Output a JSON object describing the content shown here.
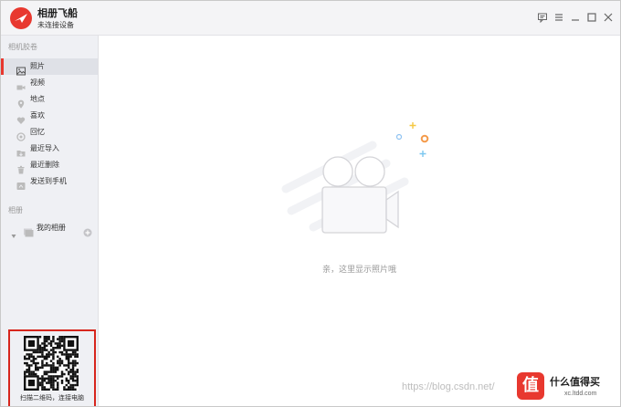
{
  "app": {
    "title": "相册飞船",
    "subtitle": "未连接设备"
  },
  "sidebar": {
    "section_local": "相机胶卷",
    "items": [
      {
        "label": "照片",
        "icon": "photo-icon",
        "active": true
      },
      {
        "label": "视频",
        "icon": "video-icon"
      },
      {
        "label": "地点",
        "icon": "location-pin-icon"
      },
      {
        "label": "喜欢",
        "icon": "heart-icon"
      },
      {
        "label": "回忆",
        "icon": "memories-icon"
      },
      {
        "label": "最近导入",
        "icon": "import-folder-icon"
      },
      {
        "label": "最近删除",
        "icon": "trash-icon"
      },
      {
        "label": "发送到手机",
        "icon": "send-to-phone-icon"
      }
    ],
    "section_albums": "相册",
    "my_album": "我的相册",
    "qr_caption": "扫描二维码，连接电脑"
  },
  "main": {
    "empty_message": "亲，这里显示照片哦"
  },
  "watermark": {
    "text": "https://blog.csdn.net/"
  },
  "corner_badge": {
    "icon_char": "值",
    "text": "什么值得买",
    "url": "xc.ltdd.com"
  },
  "colors": {
    "accent": "#e8382f",
    "sidebar_bg": "#eff0f4",
    "qr_border": "#d7261d"
  }
}
